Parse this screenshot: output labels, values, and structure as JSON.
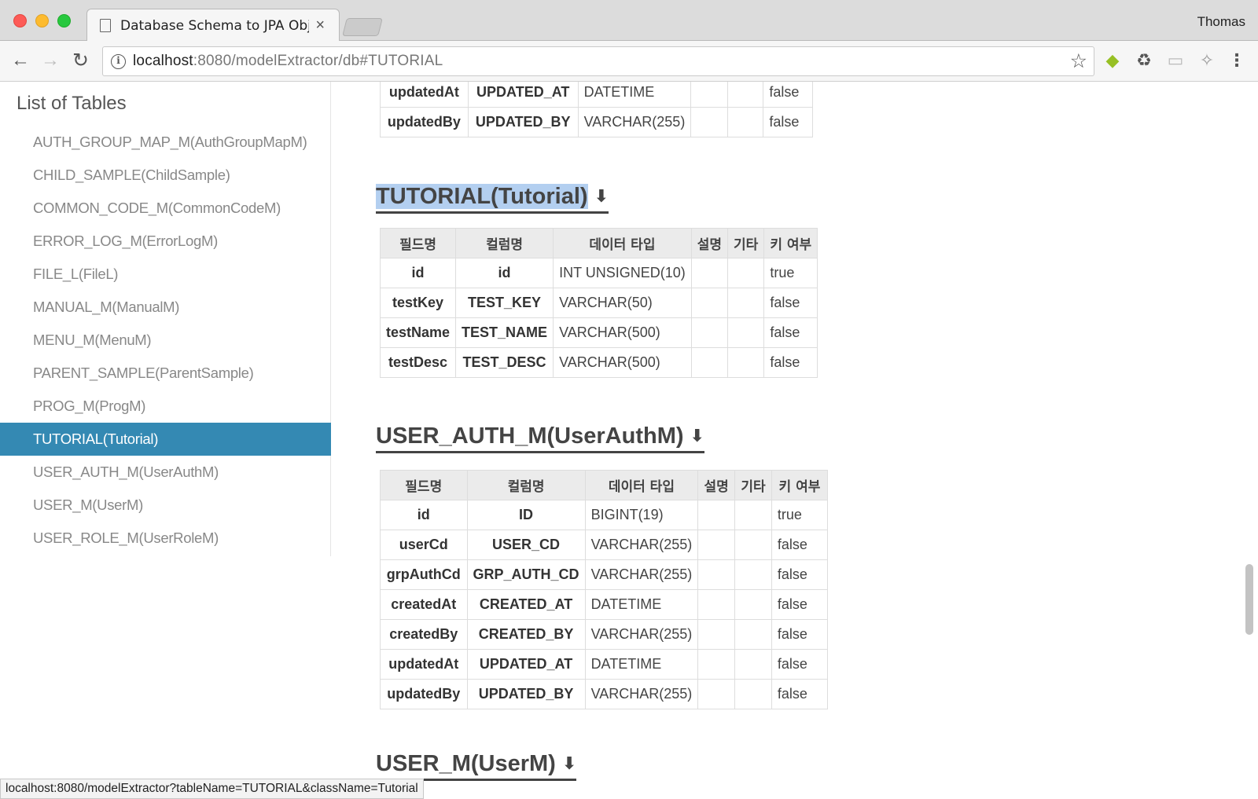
{
  "browser": {
    "tab_title": "Database Schema to JPA Objects",
    "tab_close": "×",
    "profile": "Thomas",
    "url_host": "localhost",
    "url_rest": ":8080/modelExtractor/db#TUTORIAL",
    "status_url": "localhost:8080/modelExtractor?tableName=TUTORIAL&className=Tutorial",
    "icons": {
      "back": "←",
      "forward": "→",
      "reload": "↻",
      "info": "i",
      "star": "☆",
      "android": "◆",
      "recycle": "♻",
      "cast": "▭",
      "puzzle": "✧",
      "menu": "⋮"
    }
  },
  "sidebar": {
    "title": "List of Tables",
    "items": [
      {
        "label": "AUTH_GROUP_MAP_M(AuthGroupMapM)"
      },
      {
        "label": "CHILD_SAMPLE(ChildSample)"
      },
      {
        "label": "COMMON_CODE_M(CommonCodeM)"
      },
      {
        "label": "ERROR_LOG_M(ErrorLogM)"
      },
      {
        "label": "FILE_L(FileL)"
      },
      {
        "label": "MANUAL_M(ManualM)"
      },
      {
        "label": "MENU_M(MenuM)"
      },
      {
        "label": "PARENT_SAMPLE(ParentSample)"
      },
      {
        "label": "PROG_M(ProgM)"
      },
      {
        "label": "TUTORIAL(Tutorial)"
      },
      {
        "label": "USER_AUTH_M(UserAuthM)"
      },
      {
        "label": "USER_M(UserM)"
      },
      {
        "label": "USER_ROLE_M(UserRoleM)"
      }
    ],
    "active_index": 9
  },
  "headers": [
    "필드명",
    "컬럼명",
    "데이터 타입",
    "설명",
    "기타",
    "키 여부"
  ],
  "download_icon": "⬇",
  "sections": {
    "prev_rows": [
      {
        "field": "updatedAt",
        "column": "UPDATED_AT",
        "type": "DATETIME",
        "desc": "",
        "etc": "",
        "key": "false"
      },
      {
        "field": "updatedBy",
        "column": "UPDATED_BY",
        "type": "VARCHAR(255)",
        "desc": "",
        "etc": "",
        "key": "false"
      }
    ],
    "tutorial": {
      "title": "TUTORIAL(Tutorial)",
      "rows": [
        {
          "field": "id",
          "column": "id",
          "type": "INT UNSIGNED(10)",
          "desc": "",
          "etc": "",
          "key": "true"
        },
        {
          "field": "testKey",
          "column": "TEST_KEY",
          "type": "VARCHAR(50)",
          "desc": "",
          "etc": "",
          "key": "false"
        },
        {
          "field": "testName",
          "column": "TEST_NAME",
          "type": "VARCHAR(500)",
          "desc": "",
          "etc": "",
          "key": "false"
        },
        {
          "field": "testDesc",
          "column": "TEST_DESC",
          "type": "VARCHAR(500)",
          "desc": "",
          "etc": "",
          "key": "false"
        }
      ]
    },
    "user_auth": {
      "title": "USER_AUTH_M(UserAuthM)",
      "rows": [
        {
          "field": "id",
          "column": "ID",
          "type": "BIGINT(19)",
          "desc": "",
          "etc": "",
          "key": "true"
        },
        {
          "field": "userCd",
          "column": "USER_CD",
          "type": "VARCHAR(255)",
          "desc": "",
          "etc": "",
          "key": "false"
        },
        {
          "field": "grpAuthCd",
          "column": "GRP_AUTH_CD",
          "type": "VARCHAR(255)",
          "desc": "",
          "etc": "",
          "key": "false"
        },
        {
          "field": "createdAt",
          "column": "CREATED_AT",
          "type": "DATETIME",
          "desc": "",
          "etc": "",
          "key": "false"
        },
        {
          "field": "createdBy",
          "column": "CREATED_BY",
          "type": "VARCHAR(255)",
          "desc": "",
          "etc": "",
          "key": "false"
        },
        {
          "field": "updatedAt",
          "column": "UPDATED_AT",
          "type": "DATETIME",
          "desc": "",
          "etc": "",
          "key": "false"
        },
        {
          "field": "updatedBy",
          "column": "UPDATED_BY",
          "type": "VARCHAR(255)",
          "desc": "",
          "etc": "",
          "key": "false"
        }
      ]
    },
    "user_m": {
      "title": "USER_M(UserM)"
    }
  }
}
